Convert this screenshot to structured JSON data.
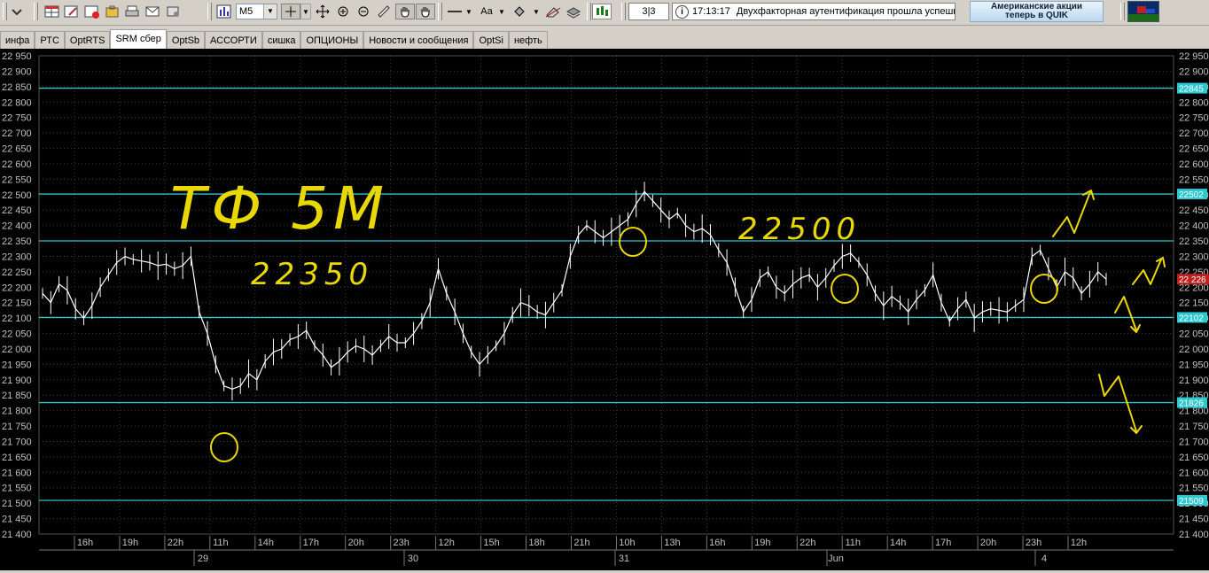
{
  "toolbar": {
    "interval": "M5",
    "font_label": "Aa",
    "page_counter": "3|3",
    "status_time": "17:13:17",
    "status_message": "Двухфакторная аутентификация прошла успешн",
    "ad_line1": "Американские акции",
    "ad_line2": "теперь в QUIK"
  },
  "tabs": [
    {
      "label": "инфа"
    },
    {
      "label": "РТС"
    },
    {
      "label": "OptRTS"
    },
    {
      "label": "SRM сбер",
      "active": true
    },
    {
      "label": "OptSb"
    },
    {
      "label": "АССОРТИ"
    },
    {
      "label": "сишка"
    },
    {
      "label": "ОПЦИОНЫ"
    },
    {
      "label": "Новости и сообщения"
    },
    {
      "label": "OptSi"
    },
    {
      "label": "нефть"
    }
  ],
  "chart_data": {
    "type": "line",
    "y_ticks": [
      "22 950",
      "22 900",
      "22 850",
      "22 800",
      "22 750",
      "22 700",
      "22 650",
      "22 600",
      "22 550",
      "22 500",
      "22 450",
      "22 400",
      "22 350",
      "22 300",
      "22 250",
      "22 200",
      "22 150",
      "22 100",
      "22 050",
      "22 000",
      "21 950",
      "21 900",
      "21 850",
      "21 800",
      "21 750",
      "21 700",
      "21 650",
      "21 600",
      "21 550",
      "21 500",
      "21 450",
      "21 400"
    ],
    "ylim": [
      21400,
      22950
    ],
    "x_hour_labels": [
      "16h",
      "19h",
      "22h",
      "11h",
      "14h",
      "17h",
      "20h",
      "23h",
      "12h",
      "15h",
      "18h",
      "21h",
      "10h",
      "13h",
      "16h",
      "19h",
      "22h",
      "11h",
      "14h",
      "17h",
      "20h",
      "23h",
      "12h"
    ],
    "x_day_labels": [
      "29",
      "30",
      "31",
      "Jun",
      "4"
    ],
    "level_lines": [
      22845,
      22502,
      22350,
      22102,
      21826,
      21509
    ],
    "level_labels": [
      {
        "value": 22845,
        "label": "22845"
      },
      {
        "value": 22502,
        "label": "22502"
      },
      {
        "value": 22102,
        "label": "22102"
      },
      {
        "value": 21826,
        "label": "21826"
      },
      {
        "value": 21509,
        "label": "21509"
      }
    ],
    "last_price": {
      "value": 22226,
      "label": "22 226"
    },
    "series": [
      {
        "values": [
          22180,
          22150,
          22210,
          22190,
          22130,
          22100,
          22140,
          22200,
          22240,
          22280,
          22300,
          22290,
          22285,
          22280,
          22270,
          22275,
          22260,
          22270,
          22300,
          22120,
          22050,
          21950,
          21880,
          21870,
          21880,
          21920,
          21900,
          21960,
          21990,
          22000,
          22030,
          22040,
          22060,
          22010,
          21980,
          21940,
          21960,
          21990,
          22010,
          22000,
          21980,
          22010,
          22040,
          22020,
          22020,
          22050,
          22090,
          22150,
          22260,
          22180,
          22120,
          22050,
          21990,
          21950,
          21980,
          22010,
          22050,
          22110,
          22150,
          22140,
          22120,
          22110,
          22150,
          22190,
          22300,
          22370,
          22400,
          22380,
          22360,
          22380,
          22400,
          22420,
          22470,
          22510,
          22480,
          22450,
          22420,
          22440,
          22400,
          22380,
          22390,
          22370,
          22320,
          22280,
          22200,
          22120,
          22160,
          22230,
          22250,
          22200,
          22180,
          22210,
          22230,
          22240,
          22200,
          22230,
          22270,
          22300,
          22310,
          22280,
          22240,
          22180,
          22140,
          22170,
          22150,
          22120,
          22160,
          22190,
          22240,
          22150,
          22090,
          22130,
          22160,
          22100,
          22120,
          22130,
          22125,
          22120,
          22140,
          22160,
          22300,
          22320,
          22260,
          22200,
          22250,
          22230,
          22180,
          22210,
          22250,
          22226
        ]
      }
    ],
    "annotations": [
      {
        "text": "ТФ 5М"
      },
      {
        "text": "22350"
      },
      {
        "text": "22500"
      }
    ]
  },
  "colors": {
    "background": "#000000",
    "grid": "#3a3a3a",
    "price_line": "#ffffff",
    "level_line": "#39c0c8",
    "level_label_bg": "#2ec8d0",
    "last_price_bg": "#c02020",
    "annotation": "#e8d800",
    "axis_text": "#c0c0c0"
  }
}
